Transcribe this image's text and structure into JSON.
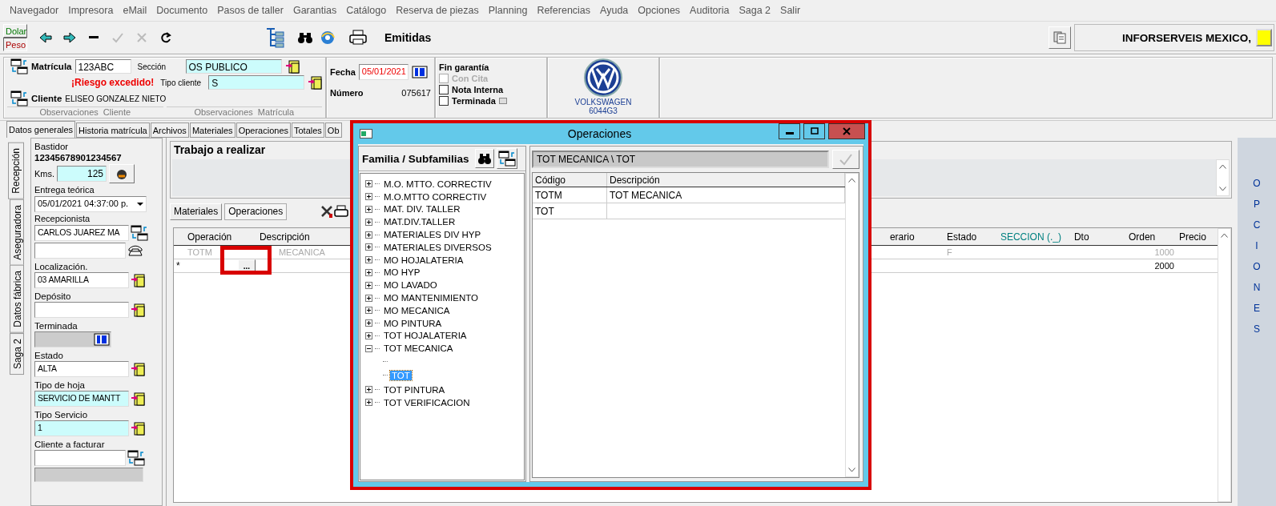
{
  "menu": [
    "Navegador",
    "Impresora",
    "eMail",
    "Documento",
    "Pasos de taller",
    "Garantias",
    "Catálogo",
    "Reserva de piezas",
    "Planning",
    "Referencias",
    "Ayuda",
    "Opciones",
    "Auditoria",
    "Saga 2",
    "Salir"
  ],
  "currency": [
    {
      "label": "Dolar",
      "selected": false
    },
    {
      "label": "Peso",
      "selected": true
    }
  ],
  "toolbar": [
    {
      "kind": "back",
      "disabled": false
    },
    {
      "kind": "forward",
      "disabled": false
    },
    {
      "kind": "minus",
      "disabled": false
    },
    {
      "kind": "check",
      "disabled": true
    },
    {
      "kind": "cancel",
      "disabled": true
    },
    {
      "kind": "redo",
      "disabled": false
    }
  ],
  "toolbar_label": "Emitidas",
  "company": "INFORSERVEIS MEXICO,",
  "header": {
    "matricula_label": "Matrícula",
    "matricula": "123ABC",
    "seccion_label": "Sección",
    "seccion": "OS PUBLICO",
    "tipo_cliente_label": "Tipo cliente",
    "tipo_cliente": "S",
    "warning": "¡Riesgo excedido!",
    "cliente_label": "Cliente",
    "cliente": "ELISEO GONZALEZ NIETO",
    "observaciones": [
      "Observaciones  Cliente",
      "Observaciones  Matrícula"
    ],
    "fecha_label": "Fecha",
    "fecha": "05/01/2021",
    "numero_label": "Número",
    "numero": "075617",
    "fin_garantia": "Fin garantía",
    "checks": [
      {
        "label": "Con Cita",
        "checked": false,
        "disabled": true
      },
      {
        "label": "Nota Interna",
        "checked": false,
        "disabled": false
      },
      {
        "label": "Terminada",
        "checked": false,
        "disabled": false
      }
    ]
  },
  "brand": {
    "name": "VOLKSWAGEN",
    "code": "6044G3"
  },
  "tabs": [
    {
      "label": "Datos generales",
      "selected": true
    },
    {
      "label": "Historia matrícula",
      "selected": false
    },
    {
      "label": "Archivos",
      "selected": false
    },
    {
      "label": "Materiales",
      "selected": false
    },
    {
      "label": "Operaciones",
      "selected": false
    },
    {
      "label": "Totales",
      "selected": false
    },
    {
      "label": "Ob",
      "selected": false
    }
  ],
  "side_tabs": [
    {
      "label": "Recepción",
      "selected": true
    },
    {
      "label": "Aseguradora",
      "selected": false
    },
    {
      "label": "Datos fábrica",
      "selected": false
    },
    {
      "label": "Saga 2",
      "selected": false
    }
  ],
  "form": {
    "bastidor_label": "Bastidor",
    "bastidor": "12345678901234567",
    "kms_label": "Kms.",
    "kms": "125",
    "entrega_label": "Entrega teórica",
    "entrega": "05/01/2021 04:37:00 p.",
    "recepcionista_label": "Recepcionista",
    "recepcionista": "CARLOS JUAREZ MA",
    "fields": [
      {
        "kind": "lookup",
        "label": "Localización.",
        "value": "03 AMARILLA",
        "highlight": false
      },
      {
        "kind": "lookup",
        "label": "Depósito",
        "highlight": false
      },
      {
        "kind": "date",
        "label": "Terminada",
        "highlight": false
      },
      {
        "kind": "lookup",
        "label": "Estado",
        "value": "ALTA",
        "highlight": false
      },
      {
        "kind": "lookup",
        "label": "Tipo de hoja",
        "value": "SERVICIO DE MANTT",
        "highlight": true
      },
      {
        "kind": "lookup",
        "label": "Tipo Servicio",
        "value": "1",
        "highlight": true
      },
      {
        "kind": "client",
        "label": "Cliente a facturar",
        "highlight": false
      }
    ]
  },
  "work": {
    "title": "Trabajo a realizar"
  },
  "subtabs": [
    {
      "label": "Materiales",
      "selected": false
    },
    {
      "label": "Operaciones",
      "selected": true
    }
  ],
  "grid": {
    "columns": [
      {
        "label": "Operación",
        "accent": false
      },
      {
        "label": "Descripción",
        "accent": false
      },
      {
        "label": "erario",
        "accent": false
      },
      {
        "label": "Estado",
        "accent": false
      },
      {
        "label": "SECCION (._)",
        "accent": true
      },
      {
        "label": "Dto",
        "accent": false
      },
      {
        "label": "Orden",
        "accent": false
      },
      {
        "label": "Precio",
        "accent": false
      }
    ],
    "rows": [
      {
        "operacion": "TOTM",
        "descripcion": "MECANICA",
        "estado": "F",
        "orden": "1000",
        "dimmed": true
      },
      {
        "marker": "*",
        "edit_button": "...",
        "orden": "2000",
        "dimmed": false
      }
    ]
  },
  "options_strip": [
    "O",
    "P",
    "C",
    "I",
    "O",
    "N",
    "E",
    "S"
  ],
  "dialog": {
    "title": "Operaciones",
    "tree_title": "Familia / Subfamilias",
    "path": "TOT MECANICA \\ TOT",
    "columns": [
      "Código",
      "Descripción"
    ],
    "rows": [
      {
        "codigo": "TOTM",
        "descripcion": "TOT MECANICA"
      },
      {
        "codigo": "TOT"
      }
    ],
    "tree": [
      {
        "label": "M.O. MTTO. CORRECTIV",
        "expanded": false,
        "selected": false
      },
      {
        "label": "M.O.MTTO CORRECTIV",
        "expanded": false,
        "selected": false
      },
      {
        "label": "MAT. DIV. TALLER",
        "expanded": false,
        "selected": false
      },
      {
        "label": "MAT.DIV.TALLER",
        "expanded": false,
        "selected": false
      },
      {
        "label": "MATERIALES DIV HYP",
        "expanded": false,
        "selected": false
      },
      {
        "label": "MATERIALES DIVERSOS",
        "expanded": false,
        "selected": false
      },
      {
        "label": "MO HOJALATERIA",
        "expanded": false,
        "selected": false
      },
      {
        "label": "MO HYP",
        "expanded": false,
        "selected": false
      },
      {
        "label": "MO LAVADO",
        "expanded": false,
        "selected": false
      },
      {
        "label": "MO MANTENIMIENTO",
        "expanded": false,
        "selected": false
      },
      {
        "label": "MO MECANICA",
        "expanded": false,
        "selected": false
      },
      {
        "label": "MO PINTURA",
        "expanded": false,
        "selected": false
      },
      {
        "label": "TOT HOJALATERIA",
        "expanded": false,
        "selected": false
      },
      {
        "label": "TOT MECANICA",
        "expanded": true,
        "selected": false,
        "children": [
          {
            "label": "TOT",
            "selected": true
          }
        ]
      },
      {
        "label": "TOT PINTURA",
        "expanded": false,
        "selected": false
      },
      {
        "label": "TOT VERIFICACION",
        "expanded": false,
        "selected": false
      }
    ]
  }
}
